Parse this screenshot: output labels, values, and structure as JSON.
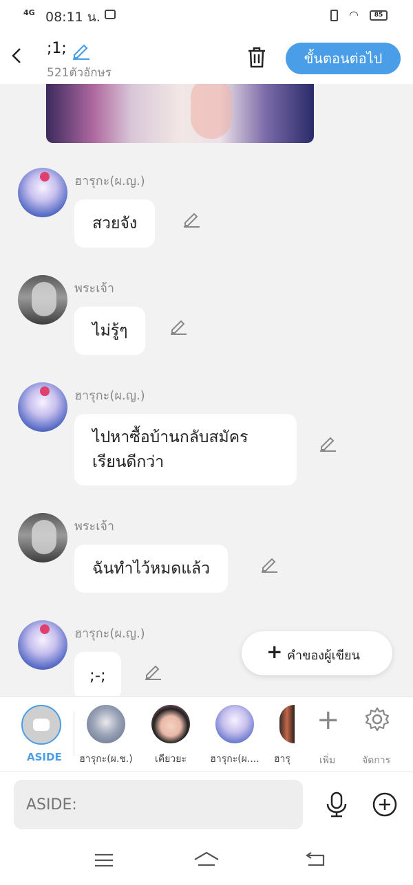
{
  "status": {
    "signal": "4G",
    "time": "08:11 น.",
    "battery": "85"
  },
  "header": {
    "title": ";1;",
    "char_count": "521ตัวอักษร",
    "next_label": "ขั้นตอนต่อไป"
  },
  "messages": [
    {
      "name": "ฮารุกะ(ผ.ญ.)",
      "text": "สวยจัง"
    },
    {
      "name": "พระเจ้า",
      "text": "ไม่รู้ๆ"
    },
    {
      "name": "ฮารุกะ(ผ.ญ.)",
      "text": "ไปหาซื้อบ้านกลับสมัคร\nเรียนดีกว่า"
    },
    {
      "name": "พระเจ้า",
      "text": "ฉันทำไว้หมดแล้ว"
    },
    {
      "name": "ฮารุกะ(ผ.ญ.)",
      "text": ";-;"
    }
  ],
  "fab": {
    "label": "คำของผู้เขียน"
  },
  "characters": {
    "aside_label": "ASIDE",
    "items": [
      "ฮารุกะ(ผ.ช.)",
      "เคียวยะ",
      "ฮารุกะ(ผ....",
      "ฮารุ"
    ],
    "add_label": "เพิ่ม",
    "manage_label": "จัดการ"
  },
  "input": {
    "placeholder": "ASIDE:"
  },
  "colors": {
    "accent": "#4a9ee8",
    "background": "#f2f2f2"
  }
}
